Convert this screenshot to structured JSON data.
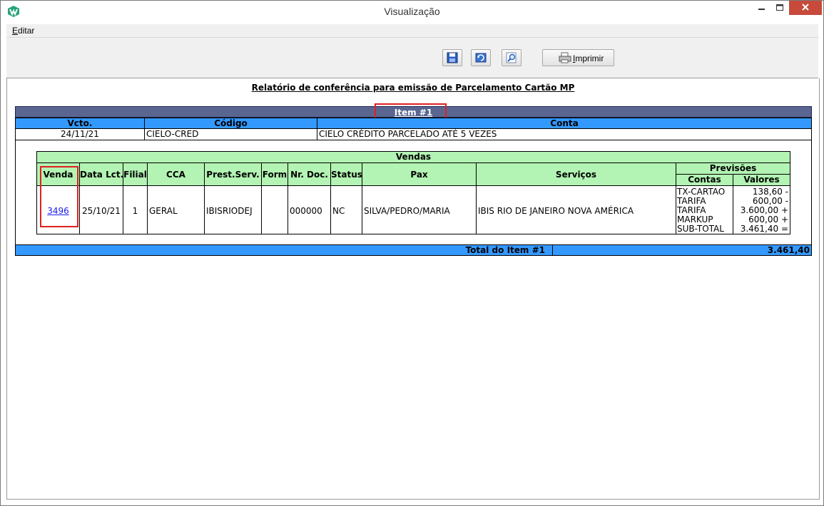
{
  "window": {
    "title": "Visualização"
  },
  "menu": {
    "edit_label": "Editar"
  },
  "toolbar": {
    "print_label": "Imprimir"
  },
  "report": {
    "title": "Relatório de conferência para emissão de Parcelamento Cartão MP",
    "item_label": "Item #1",
    "header_cols": {
      "vcto": "Vcto.",
      "codigo": "Código",
      "conta": "Conta"
    },
    "header_row": {
      "vcto": "24/11/21",
      "codigo": "CIELO-CRED",
      "conta": "CIELO CRÉDITO PARCELADO ATÉ 5 VEZES"
    },
    "vendas": {
      "title": "Vendas",
      "cols": {
        "venda": "Venda",
        "data_lct": "Data Lct.",
        "filial": "Filial",
        "cca": "CCA",
        "prest_serv": "Prest.Serv.",
        "form": "Form",
        "nr_doc": "Nr. Doc.",
        "status": "Status",
        "pax": "Pax",
        "servicos": "Serviços",
        "previsoes": "Previsões",
        "contas": "Contas",
        "valores": "Valores"
      },
      "row": {
        "venda": "3496",
        "data_lct": "25/10/21",
        "filial": "1",
        "cca": "GERAL",
        "prest_serv": "IBISRIODEJ",
        "form": "",
        "nr_doc": "000000",
        "status": "NC",
        "pax": "SILVA/PEDRO/MARIA",
        "servicos": "IBIS RIO DE JANEIRO NOVA AMÉRICA",
        "contas": [
          "TX-CARTAO",
          "TARIFA",
          "TARIFA",
          "MARKUP",
          "SUB-TOTAL"
        ],
        "valores": [
          "138,60 -",
          "600,00 -",
          "3.600,00 +",
          "600,00 +",
          "3.461,40 ="
        ]
      }
    },
    "total_label": "Total do Item #1",
    "total_value": "3.461,40"
  },
  "colors": {
    "title_bar_bg": "#5a6690",
    "header_blue": "#3399ff",
    "header_green": "#b3f3b3",
    "highlight_red": "#e02020",
    "close_button": "#c74a3a"
  },
  "icons": [
    "app-logo-icon",
    "minimize-icon",
    "maximize-icon",
    "close-icon",
    "save-icon",
    "refresh-icon",
    "zoom-icon",
    "printer-icon"
  ]
}
